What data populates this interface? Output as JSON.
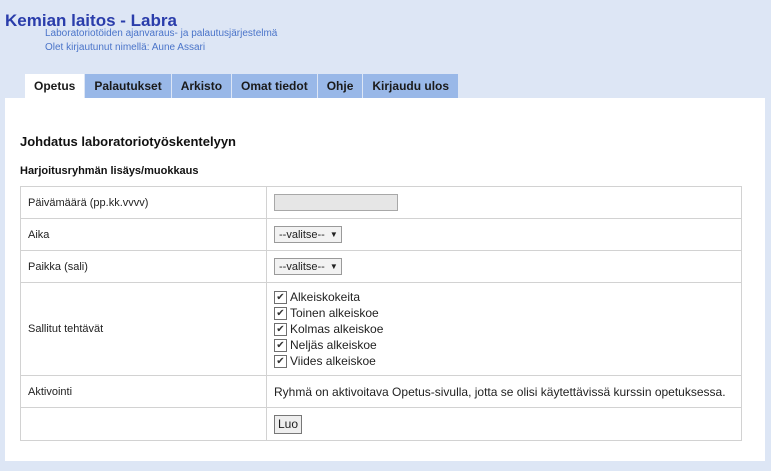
{
  "header": {
    "title": "Kemian laitos - Labra",
    "subtitle": "Laboratoriotöiden ajanvaraus- ja palautusjärjestelmä",
    "login_info": "Olet kirjautunut nimellä: Aune Assari"
  },
  "tabs": [
    {
      "label": "Opetus",
      "active": true
    },
    {
      "label": "Palautukset"
    },
    {
      "label": "Arkisto"
    },
    {
      "label": "Omat tiedot"
    },
    {
      "label": "Ohje"
    },
    {
      "label": "Kirjaudu ulos"
    }
  ],
  "main": {
    "course_title": "Johdatus laboratoriotyöskentelyyn",
    "section_title": "Harjoitusryhmän lisäys/muokkaus",
    "form": {
      "date_label": "Päivämäärä (pp.kk.vvvv)",
      "date_value": "",
      "time_label": "Aika",
      "time_select": "--valitse--",
      "place_label": "Paikka (sali)",
      "place_select": "--valitse--",
      "tasks_label": "Sallitut tehtävät",
      "tasks": [
        {
          "label": "Alkeiskokeita",
          "checked": true
        },
        {
          "label": "Toinen alkeiskoe",
          "checked": true
        },
        {
          "label": "Kolmas alkeiskoe",
          "checked": true
        },
        {
          "label": "Neljäs alkeiskoe",
          "checked": true
        },
        {
          "label": "Viides alkeiskoe",
          "checked": true
        }
      ],
      "activation_label": "Aktivointi",
      "activation_text": "Ryhmä on aktivoitava Opetus-sivulla, jotta se olisi käytettävissä kurssin opetuksessa.",
      "submit_label": "Luo"
    }
  },
  "colors": {
    "background": "#dde6f5",
    "tab": "#99b8e8",
    "title": "#2a3dab",
    "subtitle": "#4a74c9"
  }
}
